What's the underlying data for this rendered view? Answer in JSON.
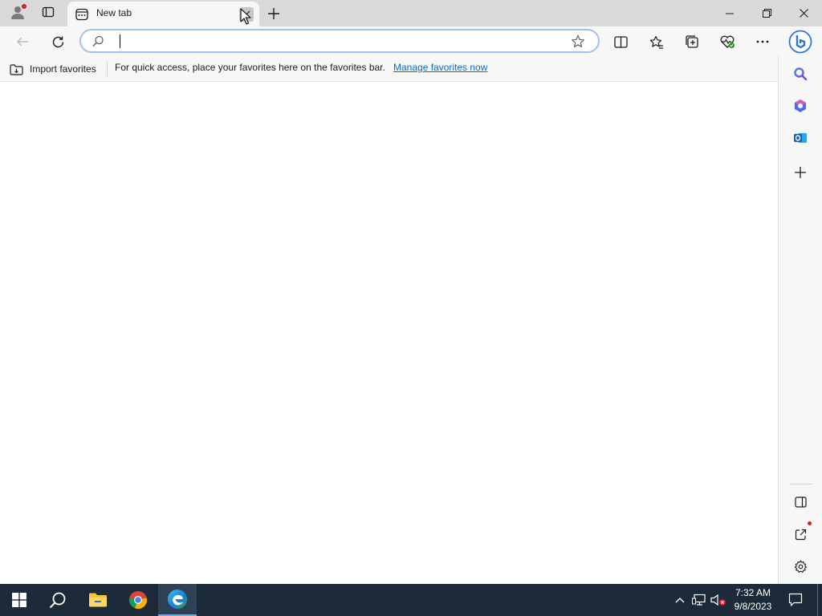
{
  "browser": {
    "tab": {
      "title": "New tab"
    },
    "address_bar": {
      "value": "",
      "placeholder": ""
    },
    "favorites_bar": {
      "import_label": "Import favorites",
      "message": "For quick access, place your favorites here on the favorites bar.",
      "manage_link": "Manage favorites now"
    }
  },
  "taskbar": {
    "clock": {
      "time": "7:32 AM",
      "date": "9/8/2023"
    }
  },
  "colors": {
    "titlebar": "#d9d9d9",
    "toolbar": "#f7f7f7",
    "address_focus": "#9fc3ea",
    "link": "#0b6bc8",
    "taskbar": "#1c2a3a",
    "notification_dot": "#c42b1c"
  },
  "icons": {
    "profile": "profile-icon",
    "tab_actions": "tab-actions-icon",
    "favicon": "new-tab-page-icon",
    "tab_close": "close-icon",
    "new_tab": "plus-icon",
    "back": "back-arrow-icon",
    "refresh": "refresh-icon",
    "search": "search-icon",
    "favorite_star": "star-icon",
    "split_screen": "split-screen-icon",
    "favorites": "favorites-icon",
    "collections": "collections-icon",
    "browser_essentials": "heart-pulse-icon",
    "more": "more-icon",
    "copilot": "bing-copilot-icon",
    "sidebar_search": "search-icon",
    "sidebar_office": "office-icon",
    "sidebar_outlook": "outlook-icon",
    "sidebar_add": "plus-icon",
    "hide_sidebar": "hide-sidebar-icon",
    "external_link": "external-link-icon",
    "settings": "gear-icon",
    "start": "windows-start-icon",
    "taskbar_search": "search-icon",
    "file_explorer": "folder-icon",
    "chrome": "chrome-icon",
    "edge": "edge-icon",
    "tray_overflow": "chevron-up-icon",
    "network": "network-icon",
    "volume": "volume-muted-icon",
    "notifications": "notification-icon"
  }
}
